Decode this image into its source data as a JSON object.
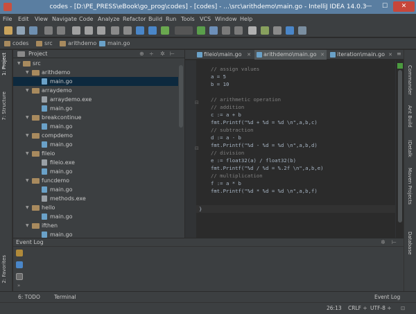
{
  "window": {
    "title": "codes - [D:\\PE_PRESS\\eBook\\go_prog\\codes] - [codes] - ...\\src\\arithdemo\\main.go - IntelliJ IDEA 14.0.3",
    "minimize": "—",
    "maximize": "☐",
    "close": "✕"
  },
  "menu": [
    "File",
    "Edit",
    "View",
    "Navigate",
    "Code",
    "Analyze",
    "Refactor",
    "Build",
    "Run",
    "Tools",
    "VCS",
    "Window",
    "Help"
  ],
  "breadcrumb": [
    "codes",
    "src",
    "arithdemo",
    "main.go"
  ],
  "left_tool_tabs": [
    "1: Project",
    "7: Structure",
    "2: Favorites"
  ],
  "right_tool_tabs": [
    "Commander",
    "Ant Build",
    "IDetalk",
    "Maven Projects",
    "Database"
  ],
  "project_panel": {
    "title": "Project",
    "tree": [
      {
        "label": "src",
        "type": "folder"
      },
      {
        "label": "arithdemo",
        "type": "folder"
      },
      {
        "label": "main.go",
        "type": "go",
        "selected": true
      },
      {
        "label": "arraydemo",
        "type": "folder"
      },
      {
        "label": "arraydemo.exe",
        "type": "exe"
      },
      {
        "label": "main.go",
        "type": "go"
      },
      {
        "label": "breakcontinue",
        "type": "folder"
      },
      {
        "label": "main.go",
        "type": "go"
      },
      {
        "label": "compdemo",
        "type": "folder"
      },
      {
        "label": "main.go",
        "type": "go"
      },
      {
        "label": "fileio",
        "type": "folder"
      },
      {
        "label": "fileio.exe",
        "type": "exe"
      },
      {
        "label": "main.go",
        "type": "go"
      },
      {
        "label": "funcdemo",
        "type": "folder"
      },
      {
        "label": "main.go",
        "type": "go"
      },
      {
        "label": "methods.exe",
        "type": "exe"
      },
      {
        "label": "hello",
        "type": "folder"
      },
      {
        "label": "main.go",
        "type": "go"
      },
      {
        "label": "ifthen",
        "type": "folder"
      },
      {
        "label": "main.go",
        "type": "go"
      }
    ]
  },
  "editor_tabs": [
    {
      "label": "fileio\\main.go"
    },
    {
      "label": "arithdemo\\main.go",
      "active": true
    },
    {
      "label": "iteration\\main.go"
    }
  ],
  "code_lines": [
    {
      "text": "// assign values",
      "comment": true
    },
    {
      "text": "a = 5"
    },
    {
      "text": "b = 10"
    },
    {
      "text": ""
    },
    {
      "text": "// arithmetic operation",
      "comment": true
    },
    {
      "text": "// addition",
      "comment": true
    },
    {
      "text": "c := a + b"
    },
    {
      "text": "fmt.Printf(\"%d + %d = %d \\n\",a,b,c)"
    },
    {
      "text": "// subtraction",
      "comment": true
    },
    {
      "text": "d := a - b"
    },
    {
      "text": "fmt.Printf(\"%d - %d = %d \\n\",a,b,d)"
    },
    {
      "text": "// division",
      "comment": true
    },
    {
      "text": "e := float32(a) / float32(b)"
    },
    {
      "text": "fmt.Printf(\"%d / %d = %.2f \\n\",a,b,e)"
    },
    {
      "text": "// multiplication",
      "comment": true
    },
    {
      "text": "f := a * b"
    },
    {
      "text": "fmt.Printf(\"%d * %d = %d \\n\",a,b,f)"
    }
  ],
  "closing_brace": "}",
  "event_log": {
    "title": "Event Log"
  },
  "bottom_tabs": {
    "todo": "6: TODO",
    "terminal": "Terminal",
    "event_log": "Event Log"
  },
  "status": {
    "position": "26:13",
    "line_sep": "CRLF ÷",
    "encoding": "UTF-8 ÷"
  }
}
